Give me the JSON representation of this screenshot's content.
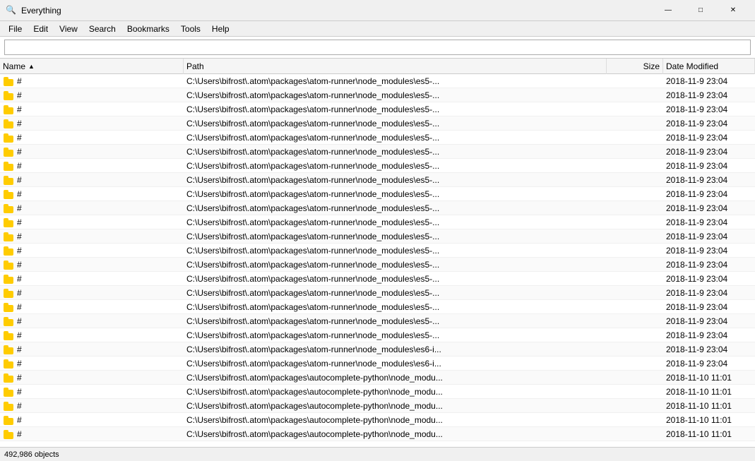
{
  "app": {
    "title": "Everything",
    "icon": "🔍"
  },
  "title_controls": {
    "minimize": "—",
    "maximize": "□",
    "close": "✕"
  },
  "menu": {
    "items": [
      "File",
      "Edit",
      "View",
      "Search",
      "Bookmarks",
      "Tools",
      "Help"
    ]
  },
  "search": {
    "placeholder": "",
    "value": ""
  },
  "columns": {
    "name": "Name",
    "path": "Path",
    "size": "Size",
    "date": "Date Modified"
  },
  "rows": [
    {
      "name": "#",
      "path": "C:\\Users\\bifrost\\.atom\\packages\\atom-runner\\node_modules\\es5-...",
      "size": "",
      "date": "2018-11-9 23:04"
    },
    {
      "name": "#",
      "path": "C:\\Users\\bifrost\\.atom\\packages\\atom-runner\\node_modules\\es5-...",
      "size": "",
      "date": "2018-11-9 23:04"
    },
    {
      "name": "#",
      "path": "C:\\Users\\bifrost\\.atom\\packages\\atom-runner\\node_modules\\es5-...",
      "size": "",
      "date": "2018-11-9 23:04"
    },
    {
      "name": "#",
      "path": "C:\\Users\\bifrost\\.atom\\packages\\atom-runner\\node_modules\\es5-...",
      "size": "",
      "date": "2018-11-9 23:04"
    },
    {
      "name": "#",
      "path": "C:\\Users\\bifrost\\.atom\\packages\\atom-runner\\node_modules\\es5-...",
      "size": "",
      "date": "2018-11-9 23:04"
    },
    {
      "name": "#",
      "path": "C:\\Users\\bifrost\\.atom\\packages\\atom-runner\\node_modules\\es5-...",
      "size": "",
      "date": "2018-11-9 23:04"
    },
    {
      "name": "#",
      "path": "C:\\Users\\bifrost\\.atom\\packages\\atom-runner\\node_modules\\es5-...",
      "size": "",
      "date": "2018-11-9 23:04"
    },
    {
      "name": "#",
      "path": "C:\\Users\\bifrost\\.atom\\packages\\atom-runner\\node_modules\\es5-...",
      "size": "",
      "date": "2018-11-9 23:04"
    },
    {
      "name": "#",
      "path": "C:\\Users\\bifrost\\.atom\\packages\\atom-runner\\node_modules\\es5-...",
      "size": "",
      "date": "2018-11-9 23:04"
    },
    {
      "name": "#",
      "path": "C:\\Users\\bifrost\\.atom\\packages\\atom-runner\\node_modules\\es5-...",
      "size": "",
      "date": "2018-11-9 23:04"
    },
    {
      "name": "#",
      "path": "C:\\Users\\bifrost\\.atom\\packages\\atom-runner\\node_modules\\es5-...",
      "size": "",
      "date": "2018-11-9 23:04"
    },
    {
      "name": "#",
      "path": "C:\\Users\\bifrost\\.atom\\packages\\atom-runner\\node_modules\\es5-...",
      "size": "",
      "date": "2018-11-9 23:04"
    },
    {
      "name": "#",
      "path": "C:\\Users\\bifrost\\.atom\\packages\\atom-runner\\node_modules\\es5-...",
      "size": "",
      "date": "2018-11-9 23:04"
    },
    {
      "name": "#",
      "path": "C:\\Users\\bifrost\\.atom\\packages\\atom-runner\\node_modules\\es5-...",
      "size": "",
      "date": "2018-11-9 23:04"
    },
    {
      "name": "#",
      "path": "C:\\Users\\bifrost\\.atom\\packages\\atom-runner\\node_modules\\es5-...",
      "size": "",
      "date": "2018-11-9 23:04"
    },
    {
      "name": "#",
      "path": "C:\\Users\\bifrost\\.atom\\packages\\atom-runner\\node_modules\\es5-...",
      "size": "",
      "date": "2018-11-9 23:04"
    },
    {
      "name": "#",
      "path": "C:\\Users\\bifrost\\.atom\\packages\\atom-runner\\node_modules\\es5-...",
      "size": "",
      "date": "2018-11-9 23:04"
    },
    {
      "name": "#",
      "path": "C:\\Users\\bifrost\\.atom\\packages\\atom-runner\\node_modules\\es5-...",
      "size": "",
      "date": "2018-11-9 23:04"
    },
    {
      "name": "#",
      "path": "C:\\Users\\bifrost\\.atom\\packages\\atom-runner\\node_modules\\es5-...",
      "size": "",
      "date": "2018-11-9 23:04"
    },
    {
      "name": "#",
      "path": "C:\\Users\\bifrost\\.atom\\packages\\atom-runner\\node_modules\\es6-i...",
      "size": "",
      "date": "2018-11-9 23:04"
    },
    {
      "name": "#",
      "path": "C:\\Users\\bifrost\\.atom\\packages\\atom-runner\\node_modules\\es6-i...",
      "size": "",
      "date": "2018-11-9 23:04"
    },
    {
      "name": "#",
      "path": "C:\\Users\\bifrost\\.atom\\packages\\autocomplete-python\\node_modu...",
      "size": "",
      "date": "2018-11-10 11:01"
    },
    {
      "name": "#",
      "path": "C:\\Users\\bifrost\\.atom\\packages\\autocomplete-python\\node_modu...",
      "size": "",
      "date": "2018-11-10 11:01"
    },
    {
      "name": "#",
      "path": "C:\\Users\\bifrost\\.atom\\packages\\autocomplete-python\\node_modu...",
      "size": "",
      "date": "2018-11-10 11:01"
    },
    {
      "name": "#",
      "path": "C:\\Users\\bifrost\\.atom\\packages\\autocomplete-python\\node_modu...",
      "size": "",
      "date": "2018-11-10 11:01"
    },
    {
      "name": "#",
      "path": "C:\\Users\\bifrost\\.atom\\packages\\autocomplete-python\\node_modu...",
      "size": "",
      "date": "2018-11-10 11:01"
    }
  ],
  "status": {
    "count": "492,986 objects"
  }
}
